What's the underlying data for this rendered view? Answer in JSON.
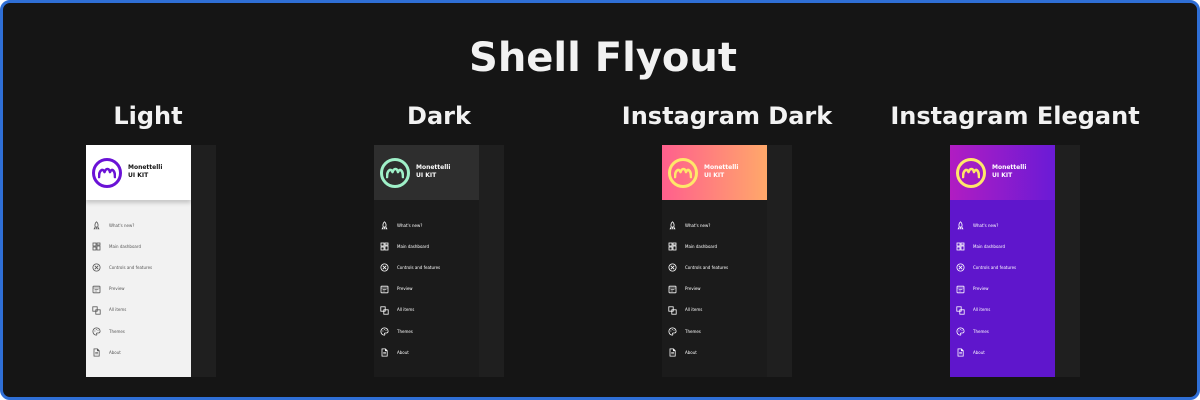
{
  "title": "Shell Flyout",
  "brand": {
    "line1": "Monettelli",
    "line2": "UI KIT"
  },
  "menu": [
    {
      "label": "What's new?",
      "icon": "rocket-icon"
    },
    {
      "label": "Main dashboard",
      "icon": "dashboard-icon"
    },
    {
      "label": "Controls and features",
      "icon": "controls-icon"
    },
    {
      "label": "Preview",
      "icon": "preview-icon"
    },
    {
      "label": "All items",
      "icon": "all-items-icon"
    },
    {
      "label": "Themes",
      "icon": "palette-icon"
    },
    {
      "label": "About",
      "icon": "document-icon"
    }
  ],
  "variants": [
    {
      "title": "Light",
      "header_bg": "#ffffff",
      "pane_bg": "#f2f2f2",
      "logo_color": "#6a12d6",
      "text_color": "#111111",
      "menu_text_color": "#555555"
    },
    {
      "title": "Dark",
      "header_bg": "#2e2e2e",
      "pane_bg": "#1b1b1b",
      "logo_color": "#9ff0c8",
      "text_color": "#ffffff",
      "menu_text_color": "#ffffff"
    },
    {
      "title": "Instagram Dark",
      "header_bg": "linear-gradient(90deg, #ff5f8d, #ffa86a)",
      "pane_bg": "#1b1b1b",
      "logo_color": "#ffe76a",
      "text_color": "#ffffff",
      "menu_text_color": "#ffffff"
    },
    {
      "title": "Instagram Elegant",
      "header_bg": "linear-gradient(90deg, #b11cc2, #6a1bd6)",
      "pane_bg": "#5f16cc",
      "logo_color": "#ffe76a",
      "text_color": "#ffffff",
      "menu_text_color": "#ffffff"
    }
  ]
}
